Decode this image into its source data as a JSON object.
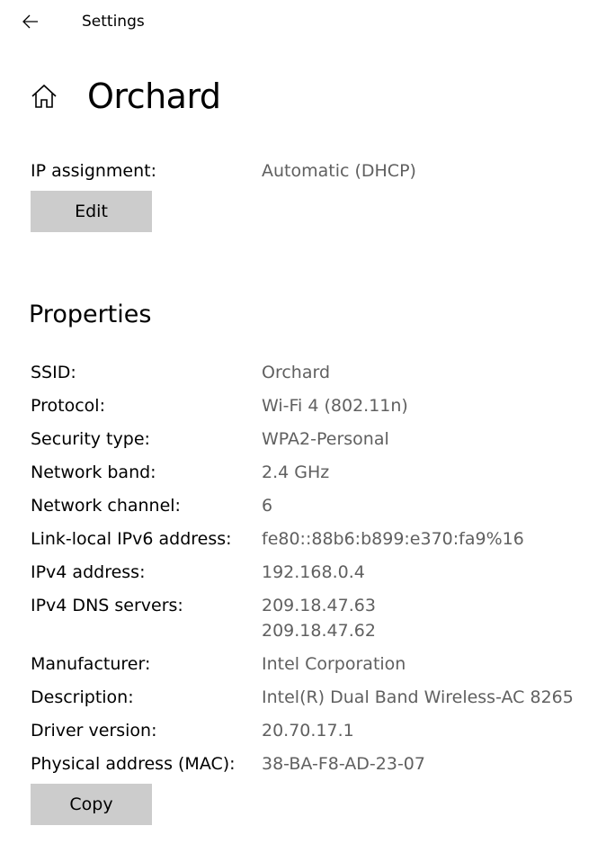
{
  "titlebar": {
    "back_icon": "back-arrow-icon",
    "title": "Settings"
  },
  "header": {
    "home_icon": "home-icon",
    "title": "Orchard"
  },
  "ip_settings": {
    "ip_assignment_label": "IP assignment:",
    "ip_assignment_value": "Automatic (DHCP)",
    "edit_label": "Edit"
  },
  "properties": {
    "heading": "Properties",
    "rows": [
      {
        "label": "SSID:",
        "value": "Orchard"
      },
      {
        "label": "Protocol:",
        "value": "Wi-Fi 4 (802.11n)"
      },
      {
        "label": "Security type:",
        "value": "WPA2-Personal"
      },
      {
        "label": "Network band:",
        "value": "2.4 GHz"
      },
      {
        "label": "Network channel:",
        "value": "6"
      },
      {
        "label": "Link-local IPv6 address:",
        "value": "fe80::88b6:b899:e370:fa9%16"
      },
      {
        "label": "IPv4 address:",
        "value": "192.168.0.4"
      },
      {
        "label": "IPv4 DNS servers:",
        "value": "209.18.47.63",
        "value2": "209.18.47.62"
      },
      {
        "label": "Manufacturer:",
        "value": "Intel Corporation"
      },
      {
        "label": "Description:",
        "value": "Intel(R) Dual Band Wireless-AC 8265"
      },
      {
        "label": "Driver version:",
        "value": "20.70.17.1"
      },
      {
        "label": "Physical address (MAC):",
        "value": "38-BA-F8-AD-23-07"
      }
    ],
    "copy_label": "Copy"
  }
}
